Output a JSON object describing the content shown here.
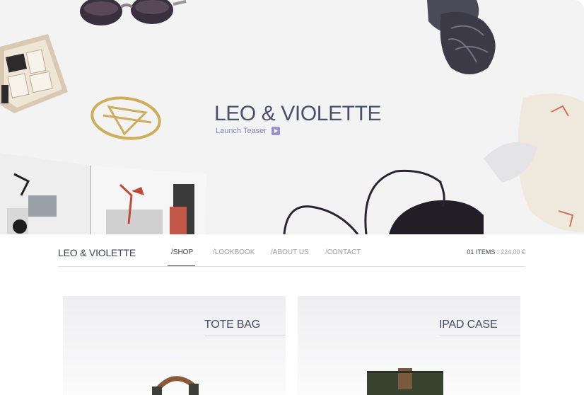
{
  "hero": {
    "title": "LEO & VIOLETTE",
    "teaser_label": "Launch Teaser"
  },
  "nav": {
    "brand": "LEO & VIOLETTE",
    "items": [
      {
        "label": "/SHOP",
        "active": true
      },
      {
        "label": "/LOOKBOOK",
        "active": false
      },
      {
        "label": "/ABOUT US",
        "active": false
      },
      {
        "label": "/CONTACT",
        "active": false
      }
    ],
    "cart": {
      "items_label": "01 ITEMS :",
      "price": "224,00 €"
    }
  },
  "products": [
    {
      "name": "TOTE BAG"
    },
    {
      "name": "IPAD CASE"
    }
  ],
  "colors": {
    "text_dark": "#3f4660",
    "accent_purple": "#9a93cc",
    "hero_background": "#f3f3f4"
  },
  "icons": {
    "teaser": "play-icon"
  }
}
